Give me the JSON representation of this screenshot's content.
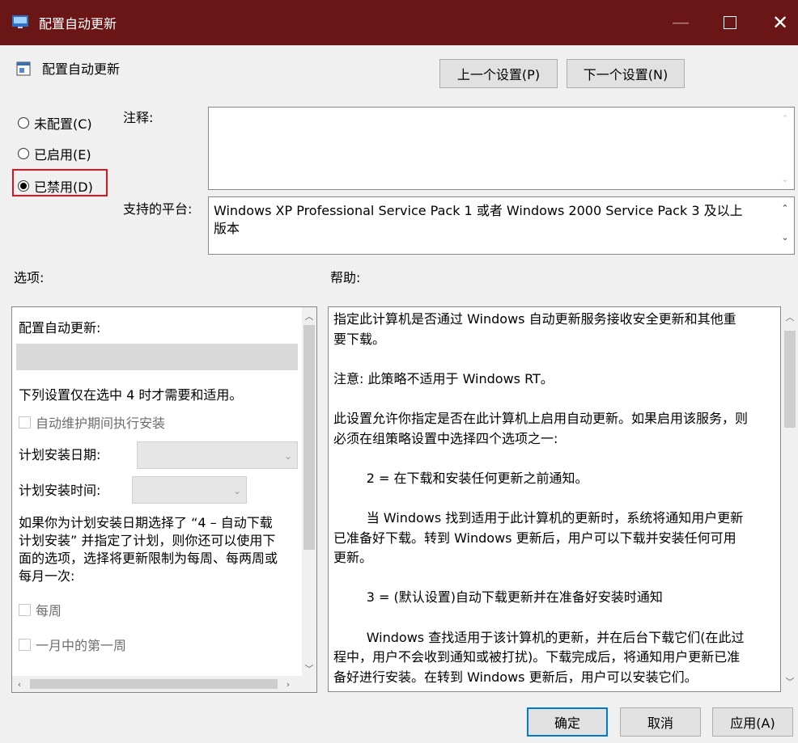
{
  "window": {
    "title": "配置自动更新",
    "icon": "policy-window-icon"
  },
  "header": {
    "policy_name": "配置自动更新",
    "prev_label": "上一个设置(P)",
    "next_label": "下一个设置(N)"
  },
  "state": {
    "not_configured": "未配置(C)",
    "enabled": "已启用(E)",
    "disabled": "已禁用(D)",
    "selected": "disabled"
  },
  "comment": {
    "label": "注释:",
    "value": ""
  },
  "platform": {
    "label": "支持的平台:",
    "lines": [
      "Windows XP Professional Service Pack 1 或者 Windows 2000 Service Pack 3 及以上",
      "版本"
    ]
  },
  "options": {
    "label": "选项:",
    "title": "配置自动更新:",
    "note": "下列设置仅在选中 4 时才需要和适用。",
    "auto_maint": "自动维护期间执行安装",
    "install_day_label": "计划安装日期:",
    "install_time_label": "计划安装时间:",
    "para": [
      "如果你为计划安装日期选择了 “4 – 自动下载",
      "计划安装” 并指定了计划，则你还可以使用下",
      "面的选项，选择将更新限制为每周、每两周或",
      "每月一次:"
    ],
    "weekly": "每周",
    "first_week": "一月中的第一周"
  },
  "help": {
    "label": "帮助:",
    "lines": [
      "指定此计算机是否通过 Windows 自动更新服务接收安全更新和其他重",
      "要下载。",
      "",
      "注意: 此策略不适用于 Windows RT。",
      "",
      "此设置允许你指定是否在此计算机上启用自动更新。如果启用该服务，则",
      "必须在组策略设置中选择四个选项之一:",
      "",
      "        2 = 在下载和安装任何更新之前通知。",
      "",
      "        当 Windows 找到适用于此计算机的更新时，系统将通知用户更新",
      "已准备好下载。转到 Windows 更新后，用户可以下载并安装任何可用",
      "更新。",
      "",
      "        3 = (默认设置)自动下载更新并在准备好安装时通知",
      "",
      "        Windows 查找适用于该计算机的更新，并在后台下载它们(在此过",
      "程中，用户不会收到通知或被打扰)。下载完成后，将通知用户更新已准",
      "备好进行安装。在转到 Windows 更新后，用户可以安装它们。"
    ]
  },
  "footer": {
    "ok": "确定",
    "cancel": "取消",
    "apply": "应用(A)"
  },
  "colors": {
    "titlebar": "#6b1616",
    "highlight": "#e0141e",
    "focus": "#0078d7"
  }
}
